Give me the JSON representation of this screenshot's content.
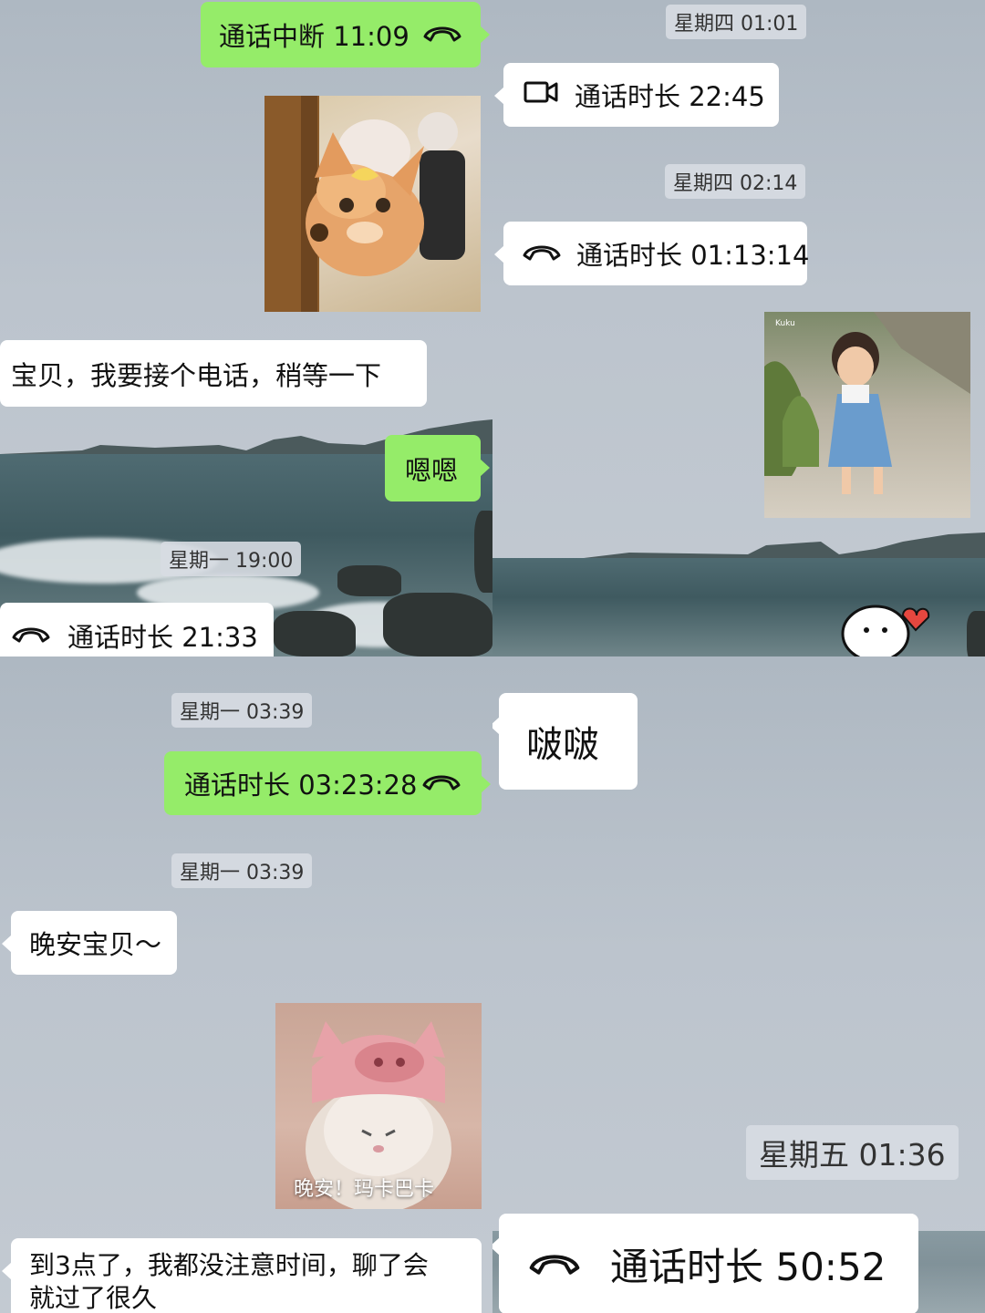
{
  "panel_top_left": {
    "msg_call_interrupted": "通话中断 11:09",
    "msg_wait": "宝贝，我要接个电话，稍等一下",
    "msg_ok": "嗯嗯",
    "stamp_1": "星期一 19:00",
    "msg_call_duration": "通话时长 21:33"
  },
  "panel_top_right": {
    "stamp_1": "星期四 01:01",
    "msg_video_call": "通话时长 22:45",
    "stamp_2": "星期四 02:14",
    "msg_call_duration": "通话时长 01:13:14"
  },
  "panel_bottom_left": {
    "stamp_1": "星期一 03:39",
    "msg_call_duration": "通话时长 03:23:28",
    "stamp_2": "星期一 03:39",
    "msg_goodnight": "晚安宝贝～",
    "sticker_caption": "晚安！玛卡巴卡",
    "msg_long_line1": "到3点了，我都没注意时间，聊了会",
    "msg_long_line2": "就过了很久"
  },
  "panel_bottom_right": {
    "msg_kiss": "啵啵",
    "stamp_1": "星期五 01:36",
    "msg_call_duration": "通话时长 50:52"
  },
  "colors": {
    "green_bubble": "#95ec69",
    "white_bubble": "#ffffff",
    "timestamp_bg": "#d7dce2"
  },
  "icons": [
    "phone-hangup-icon",
    "video-camera-icon"
  ]
}
